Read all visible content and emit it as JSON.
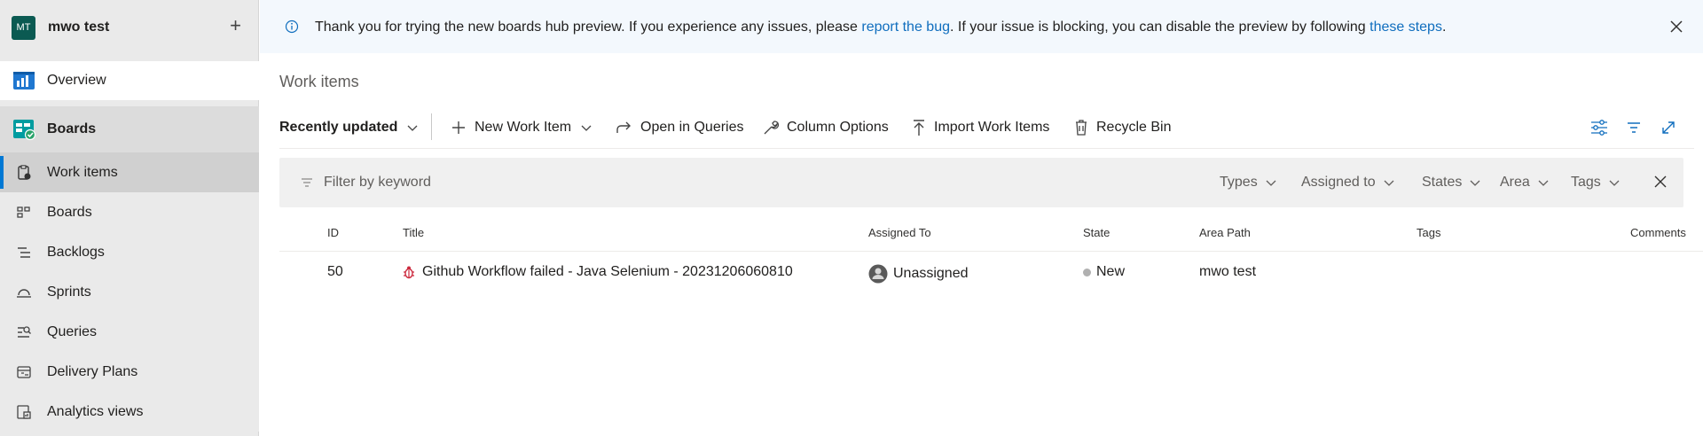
{
  "sidebar": {
    "project_initials": "MT",
    "project_name": "mwo test",
    "add_label": "+",
    "overview": "Overview",
    "boards_hub": "Boards",
    "items": [
      {
        "label": "Work items",
        "icon": "work-items-icon"
      },
      {
        "label": "Boards",
        "icon": "boards-icon"
      },
      {
        "label": "Backlogs",
        "icon": "backlogs-icon"
      },
      {
        "label": "Sprints",
        "icon": "sprints-icon"
      },
      {
        "label": "Queries",
        "icon": "queries-icon"
      },
      {
        "label": "Delivery Plans",
        "icon": "delivery-plans-icon"
      },
      {
        "label": "Analytics views",
        "icon": "analytics-views-icon"
      }
    ]
  },
  "banner": {
    "text_before": "Thank you for trying the new boards hub preview. If you experience any issues, please ",
    "link1": "report the bug",
    "text_middle": ". If your issue is blocking, you can disable the preview by following ",
    "link2": "these steps",
    "text_after": "."
  },
  "page_title": "Work items",
  "toolbar": {
    "view_selector": "Recently updated",
    "new_work_item": "New Work Item",
    "open_in_queries": "Open in Queries",
    "column_options": "Column Options",
    "import_work_items": "Import Work Items",
    "recycle_bin": "Recycle Bin"
  },
  "filter": {
    "placeholder": "Filter by keyword",
    "pills": [
      "Types",
      "Assigned to",
      "States",
      "Area",
      "Tags"
    ]
  },
  "grid": {
    "columns": [
      "ID",
      "Title",
      "Assigned To",
      "State",
      "Area Path",
      "Tags",
      "Comments"
    ],
    "rows": [
      {
        "id": "50",
        "title": "Github Workflow failed - Java Selenium - 20231206060810",
        "assigned_to": "Unassigned",
        "state": "New",
        "area_path": "mwo test",
        "tags": "",
        "comments": ""
      }
    ]
  },
  "colors": {
    "accent": "#0078d4",
    "link": "#106ebe",
    "avatar": "#0b5a52",
    "bug": "#cc293d"
  }
}
